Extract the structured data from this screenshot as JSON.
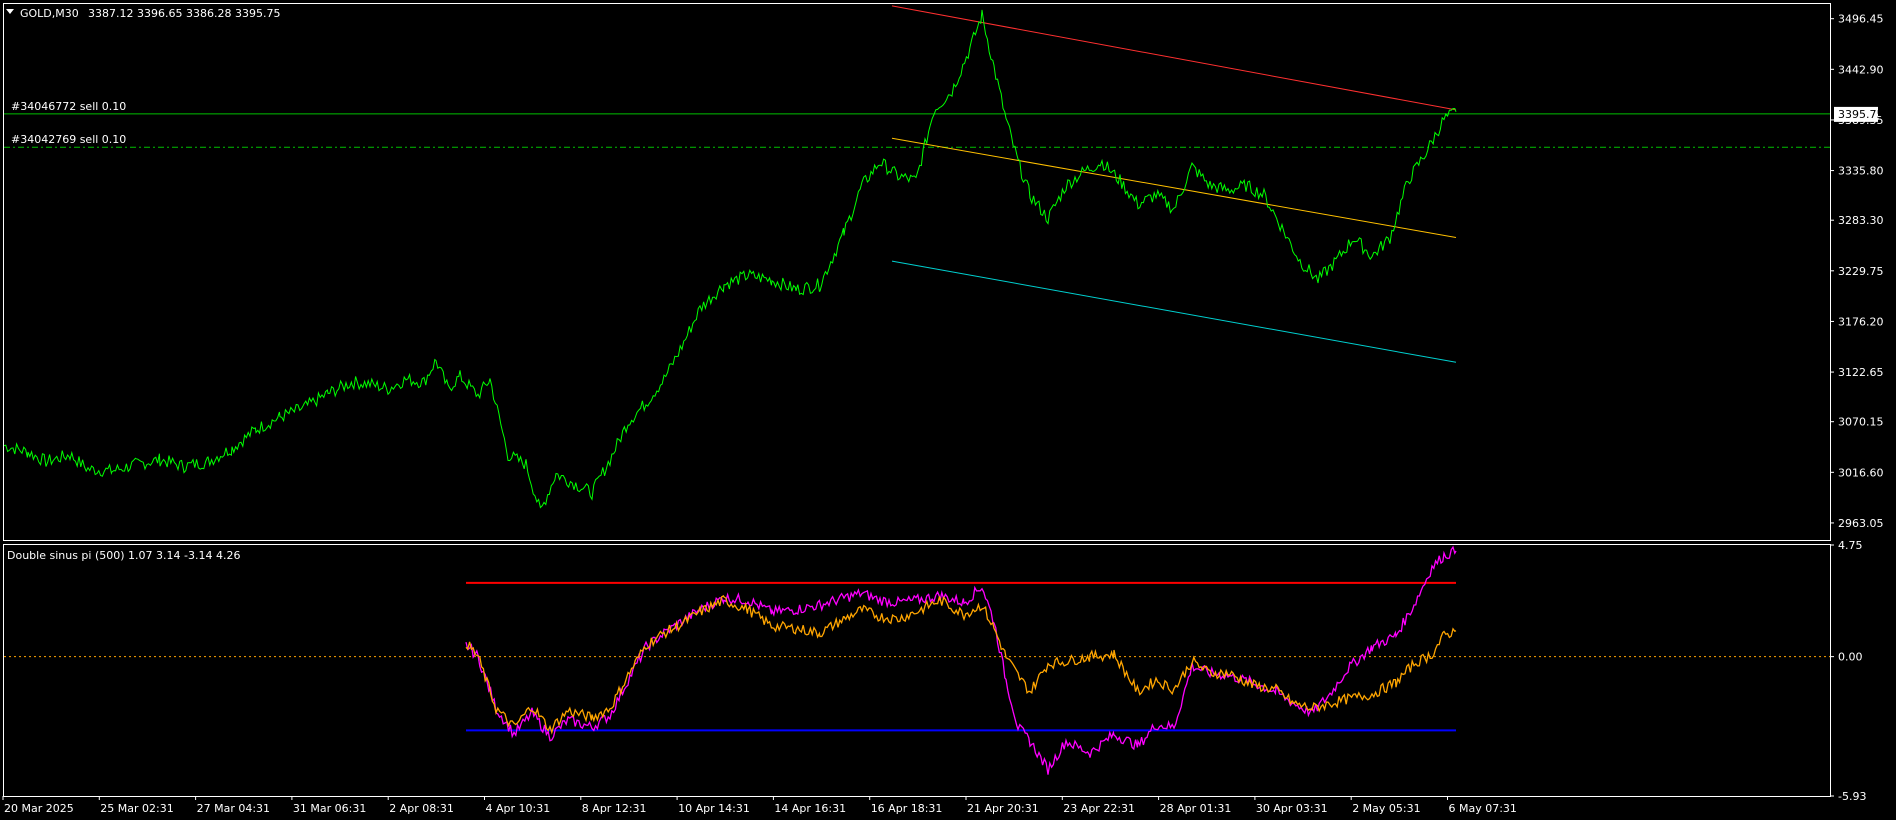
{
  "colors": {
    "background": "#000000",
    "frame": "#ffffff",
    "price": "#00ff00",
    "trade_line": "#00c000",
    "channel_upper": "#ff3030",
    "channel_mid": "#ffc000",
    "channel_lower": "#00d0d0",
    "ind_magenta": "#ff00ff",
    "ind_orange": "#ffa500",
    "ind_upper": "#ff0000",
    "ind_lower": "#0000ff",
    "ind_zero": "#ffa500"
  },
  "main": {
    "header_symbol": "GOLD,M30",
    "header_ohlc": "3387.12 3396.65 3386.28 3395.75",
    "current_price_label": "3395.75",
    "orders": [
      {
        "label": "#34046772 sell 0.10",
        "price": 3395.75
      },
      {
        "label": "#34042769 sell 0.10",
        "price": 3360.5
      }
    ]
  },
  "indicator": {
    "title": "Double sinus pi (500) 1.07 3.14 -3.14 4.26",
    "axis_labels": [
      "4.75",
      "0.00",
      "-5.93"
    ]
  },
  "chart_data": [
    {
      "type": "line",
      "title": "GOLD,M30",
      "ylim": [
        2945,
        3512
      ],
      "y_ticks": [
        3496.45,
        3442.9,
        3389.35,
        3335.8,
        3283.3,
        3229.75,
        3176.2,
        3122.65,
        3070.15,
        3016.6,
        2963.05
      ],
      "y_tick_labels": [
        "3496.45",
        "3442.90",
        "3389.35",
        "3335.80",
        "3283.30",
        "3229.75",
        "3176.20",
        "3122.65",
        "3070.15",
        "3016.60",
        "2963.05"
      ],
      "x_labels": [
        "20 Mar 2025",
        "25 Mar 02:31",
        "27 Mar 04:31",
        "31 Mar 06:31",
        "2 Apr 08:31",
        "4 Apr 10:31",
        "8 Apr 12:31",
        "10 Apr 14:31",
        "14 Apr 16:31",
        "16 Apr 18:31",
        "21 Apr 20:31",
        "23 Apr 22:31",
        "28 Apr 01:31",
        "30 Apr 03:31",
        "2 May 05:31",
        "6 May 07:31"
      ],
      "x_range": [
        0,
        1500
      ],
      "series": [
        {
          "points": [
            [
              0,
              3045
            ],
            [
              20,
              3038
            ],
            [
              35,
              3028
            ],
            [
              55,
              3035
            ],
            [
              70,
              3020
            ],
            [
              90,
              3018
            ],
            [
              110,
              3025
            ],
            [
              130,
              3030
            ],
            [
              150,
              3023
            ],
            [
              170,
              3028
            ],
            [
              190,
              3042
            ],
            [
              210,
              3062
            ],
            [
              230,
              3075
            ],
            [
              250,
              3085
            ],
            [
              270,
              3100
            ],
            [
              290,
              3112
            ],
            [
              305,
              3110
            ],
            [
              320,
              3105
            ],
            [
              335,
              3115
            ],
            [
              350,
              3112
            ],
            [
              360,
              3135
            ],
            [
              370,
              3105
            ],
            [
              380,
              3118
            ],
            [
              395,
              3098
            ],
            [
              405,
              3115
            ],
            [
              420,
              3035
            ],
            [
              435,
              3025
            ],
            [
              447,
              2975
            ],
            [
              460,
              3015
            ],
            [
              475,
              3005
            ],
            [
              490,
              2995
            ],
            [
              505,
              3030
            ],
            [
              520,
              3070
            ],
            [
              535,
              3090
            ],
            [
              550,
              3115
            ],
            [
              565,
              3150
            ],
            [
              580,
              3190
            ],
            [
              600,
              3215
            ],
            [
              620,
              3225
            ],
            [
              640,
              3220
            ],
            [
              660,
              3210
            ],
            [
              680,
              3215
            ],
            [
              700,
              3270
            ],
            [
              715,
              3320
            ],
            [
              730,
              3345
            ],
            [
              745,
              3330
            ],
            [
              760,
              3325
            ],
            [
              775,
              3400
            ],
            [
              790,
              3420
            ],
            [
              805,
              3465
            ],
            [
              815,
              3500
            ],
            [
              825,
              3445
            ],
            [
              835,
              3390
            ],
            [
              845,
              3345
            ],
            [
              855,
              3310
            ],
            [
              870,
              3285
            ],
            [
              885,
              3320
            ],
            [
              900,
              3335
            ],
            [
              915,
              3345
            ],
            [
              930,
              3325
            ],
            [
              945,
              3300
            ],
            [
              960,
              3310
            ],
            [
              975,
              3295
            ],
            [
              990,
              3340
            ],
            [
              1005,
              3320
            ],
            [
              1020,
              3315
            ],
            [
              1035,
              3320
            ],
            [
              1050,
              3310
            ],
            [
              1065,
              3275
            ],
            [
              1080,
              3240
            ],
            [
              1095,
              3220
            ],
            [
              1110,
              3240
            ],
            [
              1125,
              3265
            ],
            [
              1140,
              3245
            ],
            [
              1155,
              3265
            ],
            [
              1170,
              3325
            ],
            [
              1185,
              3355
            ],
            [
              1200,
              3390
            ],
            [
              1210,
              3398
            ]
          ]
        }
      ],
      "trendlines": [
        {
          "name": "upper",
          "points": [
            [
              740,
              3510
            ],
            [
              1210,
              3400
            ]
          ]
        },
        {
          "name": "middle",
          "points": [
            [
              740,
              3370
            ],
            [
              1210,
              3265
            ]
          ]
        },
        {
          "name": "lower",
          "points": [
            [
              740,
              3240
            ],
            [
              1210,
              3133
            ]
          ]
        }
      ]
    },
    {
      "type": "line",
      "title": "Double sinus pi (500) 1.07 3.14 -3.14 4.26",
      "ylim": [
        -5.93,
        4.75
      ],
      "levels": [
        3.14,
        0.0,
        -3.14
      ],
      "x_range": [
        0,
        1500
      ],
      "series": [
        {
          "color_key": "ind_magenta",
          "points": [
            [
              385,
              0.5
            ],
            [
              395,
              0.0
            ],
            [
              410,
              -2.2
            ],
            [
              425,
              -3.3
            ],
            [
              440,
              -2.4
            ],
            [
              455,
              -3.4
            ],
            [
              470,
              -2.7
            ],
            [
              490,
              -3.0
            ],
            [
              505,
              -2.5
            ],
            [
              520,
              -1.0
            ],
            [
              535,
              0.4
            ],
            [
              550,
              1.0
            ],
            [
              565,
              1.5
            ],
            [
              580,
              2.0
            ],
            [
              600,
              2.5
            ],
            [
              620,
              2.4
            ],
            [
              640,
              1.9
            ],
            [
              660,
              2.0
            ],
            [
              680,
              2.2
            ],
            [
              700,
              2.5
            ],
            [
              715,
              2.7
            ],
            [
              730,
              2.4
            ],
            [
              745,
              2.3
            ],
            [
              760,
              2.4
            ],
            [
              780,
              2.6
            ],
            [
              800,
              2.3
            ],
            [
              815,
              3.0
            ],
            [
              825,
              1.5
            ],
            [
              835,
              -1.0
            ],
            [
              845,
              -3.0
            ],
            [
              855,
              -3.6
            ],
            [
              870,
              -4.8
            ],
            [
              885,
              -3.6
            ],
            [
              905,
              -4.1
            ],
            [
              925,
              -3.3
            ],
            [
              945,
              -3.8
            ],
            [
              960,
              -2.9
            ],
            [
              975,
              -3.0
            ],
            [
              990,
              -0.4
            ],
            [
              1005,
              -0.7
            ],
            [
              1020,
              -0.8
            ],
            [
              1040,
              -1.1
            ],
            [
              1060,
              -1.5
            ],
            [
              1075,
              -2.0
            ],
            [
              1090,
              -2.4
            ],
            [
              1105,
              -1.6
            ],
            [
              1120,
              -0.5
            ],
            [
              1140,
              0.4
            ],
            [
              1160,
              0.9
            ],
            [
              1175,
              2.2
            ],
            [
              1190,
              3.8
            ],
            [
              1200,
              4.3
            ],
            [
              1210,
              4.5
            ]
          ]
        },
        {
          "color_key": "ind_orange",
          "points": [
            [
              385,
              0.6
            ],
            [
              395,
              0.0
            ],
            [
              410,
              -2.2
            ],
            [
              425,
              -3.0
            ],
            [
              440,
              -2.1
            ],
            [
              455,
              -3.1
            ],
            [
              470,
              -2.3
            ],
            [
              490,
              -2.6
            ],
            [
              505,
              -2.2
            ],
            [
              520,
              -0.8
            ],
            [
              535,
              0.5
            ],
            [
              550,
              1.0
            ],
            [
              565,
              1.4
            ],
            [
              580,
              1.9
            ],
            [
              600,
              2.4
            ],
            [
              620,
              2.0
            ],
            [
              640,
              1.3
            ],
            [
              660,
              1.2
            ],
            [
              680,
              1.0
            ],
            [
              700,
              1.6
            ],
            [
              715,
              2.0
            ],
            [
              730,
              1.7
            ],
            [
              745,
              1.6
            ],
            [
              760,
              1.9
            ],
            [
              780,
              2.4
            ],
            [
              800,
              1.8
            ],
            [
              815,
              2.2
            ],
            [
              825,
              1.2
            ],
            [
              835,
              0.0
            ],
            [
              845,
              -0.8
            ],
            [
              855,
              -1.5
            ],
            [
              870,
              -0.3
            ],
            [
              885,
              -0.2
            ],
            [
              905,
              0.0
            ],
            [
              925,
              0.1
            ],
            [
              945,
              -1.5
            ],
            [
              960,
              -1.0
            ],
            [
              975,
              -1.4
            ],
            [
              990,
              -0.2
            ],
            [
              1005,
              -0.7
            ],
            [
              1020,
              -0.7
            ],
            [
              1040,
              -1.2
            ],
            [
              1060,
              -1.4
            ],
            [
              1075,
              -2.0
            ],
            [
              1090,
              -2.2
            ],
            [
              1105,
              -2.0
            ],
            [
              1120,
              -1.8
            ],
            [
              1140,
              -1.6
            ],
            [
              1160,
              -1.1
            ],
            [
              1175,
              -0.3
            ],
            [
              1190,
              0.1
            ],
            [
              1200,
              0.9
            ],
            [
              1210,
              1.1
            ]
          ]
        }
      ]
    }
  ]
}
